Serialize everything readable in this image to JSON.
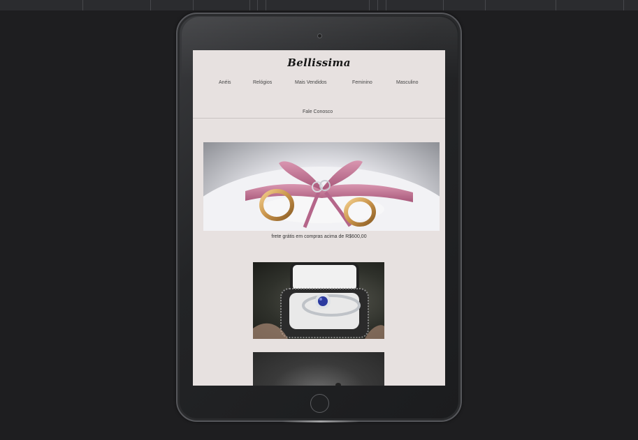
{
  "site": {
    "logo": "Bellissima"
  },
  "nav": {
    "items": [
      {
        "label": "Anéis"
      },
      {
        "label": "Relógios"
      },
      {
        "label": "Mais Vendidos"
      },
      {
        "label": "Feminino"
      },
      {
        "label": "Masculino"
      },
      {
        "label": "Fale Conosco"
      }
    ]
  },
  "banner": {
    "caption": "frete grátis em compras acima de R$600,00"
  },
  "colors": {
    "page_background": "#e7e1e0",
    "ribbon": "#c77e9a",
    "desktop_background": "#1e1e20"
  },
  "icons": {
    "camera": "camera-icon",
    "home": "home-button-icon"
  }
}
